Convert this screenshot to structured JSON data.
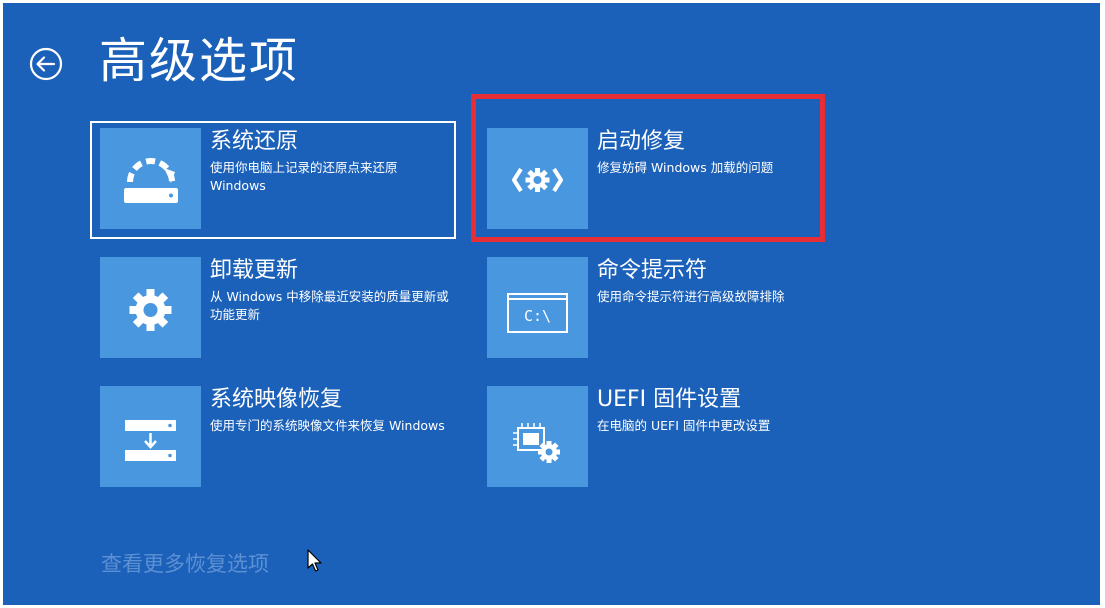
{
  "header": {
    "title": "高级选项"
  },
  "options": [
    {
      "title": "系统还原",
      "desc": "使用你电脑上记录的还原点来还原 Windows",
      "icon": "system-restore-icon"
    },
    {
      "title": "启动修复",
      "desc": "修复妨碍 Windows 加载的问题",
      "icon": "startup-repair-icon"
    },
    {
      "title": "卸载更新",
      "desc": "从 Windows 中移除最近安装的质量更新或功能更新",
      "icon": "gear-icon"
    },
    {
      "title": "命令提示符",
      "desc": "使用命令提示符进行高级故障排除",
      "icon": "command-prompt-icon",
      "icon_text": "C:\\"
    },
    {
      "title": "系统映像恢复",
      "desc": "使用专门的系统映像文件来恢复 Windows",
      "icon": "system-image-icon"
    },
    {
      "title": "UEFI 固件设置",
      "desc": "在电脑的 UEFI 固件中更改设置",
      "icon": "uefi-firmware-icon"
    }
  ],
  "footer": {
    "more_link": "查看更多恢复选项"
  },
  "colors": {
    "background": "#1b61b9",
    "tile_icon": "#4997df",
    "highlight": "#e72d36",
    "link": "#5d90d3"
  }
}
